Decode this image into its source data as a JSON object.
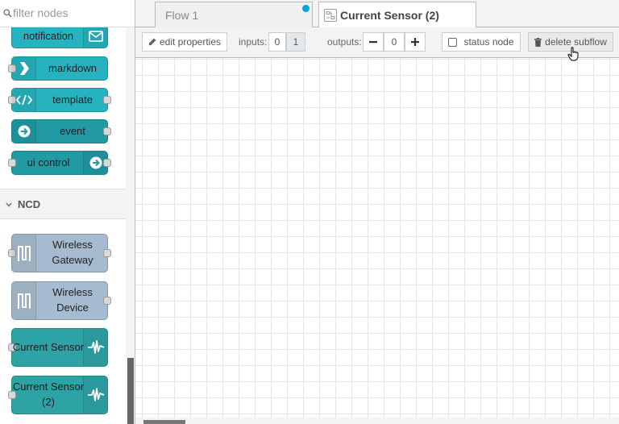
{
  "search": {
    "placeholder": "filter nodes"
  },
  "palette": {
    "top_nodes": [
      {
        "label": "notification",
        "icon": "envelope-icon"
      },
      {
        "label": "markdown",
        "icon": "markdown-arrow-icon"
      },
      {
        "label": "template",
        "icon": "code-icon"
      },
      {
        "label": "event",
        "icon": "arrow-circle-right-icon"
      },
      {
        "label": "ui control",
        "icon": "arrow-circle-right-icon"
      }
    ],
    "category": {
      "title": "NCD",
      "chevron": "chevron-down-icon"
    },
    "ncd_nodes": [
      {
        "label": "Wireless Gateway",
        "icon": "wireless-wave-icon"
      },
      {
        "label": "Wireless Device",
        "icon": "wireless-wave-icon"
      },
      {
        "label": "Current Sensor",
        "icon": "pulse-icon"
      },
      {
        "label": "Current Sensor (2)",
        "icon": "pulse-icon"
      }
    ]
  },
  "tabs": [
    {
      "label": "Flow 1",
      "active": false,
      "changed": true
    },
    {
      "label": "Current Sensor (2)",
      "active": true,
      "icon": "subflow-icon"
    }
  ],
  "toolbar": {
    "edit_properties": "edit properties",
    "inputs_label": "inputs:",
    "inputs_options": [
      "0",
      "1"
    ],
    "inputs_selected": "1",
    "outputs_label": "outputs:",
    "outputs_value": "0",
    "status_node": "status node",
    "delete_subflow": "delete subflow"
  },
  "colors": {
    "dashboard_node": "#26b3bf",
    "ncd_node": "#a6bbcf",
    "sensor_node": "#2ea3a6",
    "changed_dot": "#00a6e0"
  }
}
